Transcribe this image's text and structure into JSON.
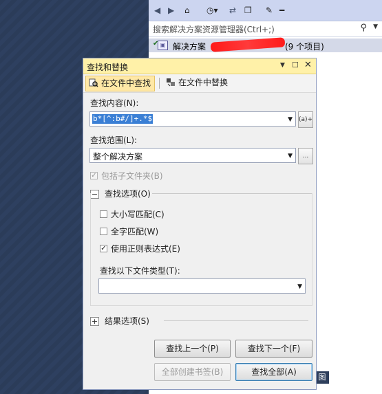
{
  "solution_explorer": {
    "search_placeholder": "搜索解决方案资源管理器(Ctrl+;)",
    "solution_label": "解决方案",
    "item_count": "(9 个项目)",
    "footer_tab": "图"
  },
  "dialog": {
    "title": "查找和替换",
    "tabs": [
      {
        "label": "在文件中查找"
      },
      {
        "label": "在文件中替换"
      }
    ],
    "find_what_label": "查找内容(N):",
    "find_what_value": "b*[^:b#/]+.*$",
    "regex_builder_button": "(a)+",
    "look_in_label": "查找范围(L):",
    "look_in_value": "整个解决方案",
    "browse_button": "...",
    "include_subfolders_label": "包括子文件夹(B)",
    "find_options_label": "查找选项(O)",
    "match_case_label": "大小写匹配(C)",
    "match_whole_word_label": "全字匹配(W)",
    "use_regex_label": "使用正则表达式(E)",
    "file_types_label": "查找以下文件类型(T):",
    "file_types_value": "",
    "result_options_label": "结果选项(S)",
    "find_previous_button": "查找上一个(P)",
    "find_next_button": "查找下一个(F)",
    "bookmark_all_button": "全部创建书签(B)",
    "find_all_button": "查找全部(A)"
  },
  "checkbox_states": {
    "include_subfolders": true,
    "match_case": false,
    "match_whole_word": false,
    "use_regex": true
  },
  "colors": {
    "titlebar": "#fff1a8",
    "active_tab": "#ffe8a6",
    "selection": "#3a7fd5",
    "background": "#2b3c59"
  }
}
